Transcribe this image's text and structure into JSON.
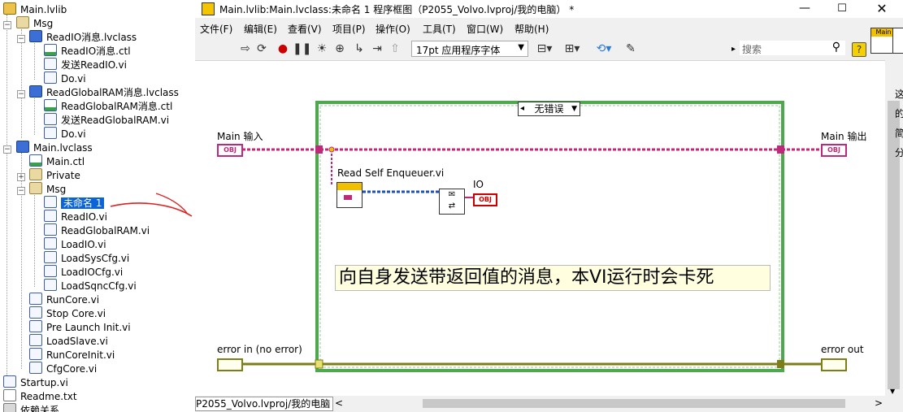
{
  "tree": {
    "items": [
      {
        "label": "Main.lvlib",
        "icon": "library-icon"
      },
      {
        "label": "Msg",
        "icon": "folder-icon"
      },
      {
        "label": "ReadIO消息.lvclass",
        "icon": "class-icon"
      },
      {
        "label": "ReadIO消息.ctl",
        "icon": "control-icon"
      },
      {
        "label": "发送ReadIO.vi",
        "icon": "vi-icon"
      },
      {
        "label": "Do.vi",
        "icon": "vi-icon"
      },
      {
        "label": "ReadGlobalRAM消息.lvclass",
        "icon": "class-icon"
      },
      {
        "label": "ReadGlobalRAM消息.ctl",
        "icon": "control-icon"
      },
      {
        "label": "发送ReadGlobalRAM.vi",
        "icon": "vi-icon"
      },
      {
        "label": "Do.vi",
        "icon": "vi-icon"
      },
      {
        "label": "Main.lvclass",
        "icon": "class-icon"
      },
      {
        "label": "Main.ctl",
        "icon": "control-icon"
      },
      {
        "label": "Private",
        "icon": "folder-icon"
      },
      {
        "label": "Msg",
        "icon": "folder-icon"
      },
      {
        "label": "未命名 1",
        "icon": "vi-icon"
      },
      {
        "label": "ReadIO.vi",
        "icon": "vi-icon"
      },
      {
        "label": "ReadGlobalRAM.vi",
        "icon": "vi-icon"
      },
      {
        "label": "LoadIO.vi",
        "icon": "vi-icon"
      },
      {
        "label": "LoadSysCfg.vi",
        "icon": "vi-icon"
      },
      {
        "label": "LoadIOCfg.vi",
        "icon": "vi-icon"
      },
      {
        "label": "LoadSqncCfg.vi",
        "icon": "vi-icon"
      },
      {
        "label": "RunCore.vi",
        "icon": "vi-icon"
      },
      {
        "label": "Stop Core.vi",
        "icon": "vi-icon"
      },
      {
        "label": "Pre Launch Init.vi",
        "icon": "vi-icon"
      },
      {
        "label": "LoadSlave.vi",
        "icon": "vi-icon"
      },
      {
        "label": "RunCoreInit.vi",
        "icon": "vi-icon"
      },
      {
        "label": "CfgCore.vi",
        "icon": "vi-icon"
      },
      {
        "label": "Startup.vi",
        "icon": "vi-icon"
      },
      {
        "label": "Readme.txt",
        "icon": "text-file-icon"
      },
      {
        "label": "依赖关系",
        "icon": "dependencies-icon"
      }
    ]
  },
  "window": {
    "title": "Main.lvlib:Main.lvclass:未命名 1 程序框图（P2055_Volvo.lvproj/我的电脑） *",
    "menus": [
      "文件(F)",
      "编辑(E)",
      "查看(V)",
      "项目(P)",
      "操作(O)",
      "工具(T)",
      "窗口(W)",
      "帮助(H)"
    ],
    "font_select": "17pt 应用程序字体",
    "search_placeholder": "搜索",
    "status_path": "P2055_Volvo.lvproj/我的电脑",
    "icon_label": "Main"
  },
  "diagram": {
    "case_selector": "无错误",
    "main_in": "Main 输入",
    "main_out": "Main 输出",
    "error_in": "error in (no error)",
    "error_out": "error out",
    "node_label": "Read Self Enqueuer.vi",
    "io_label": "IO",
    "comment": "向自身发送带返回值的消息，本VI运行时会卡死",
    "obj_tag": "OBJ",
    "side_text": [
      "这",
      "的",
      "简",
      "分"
    ]
  },
  "colors": {
    "class_wire": "#c0287a",
    "error_wire": "#7d7d1a",
    "case_border": "#4ea84e",
    "selection": "#0a64d8",
    "annotation_arrow": "#e02020"
  }
}
